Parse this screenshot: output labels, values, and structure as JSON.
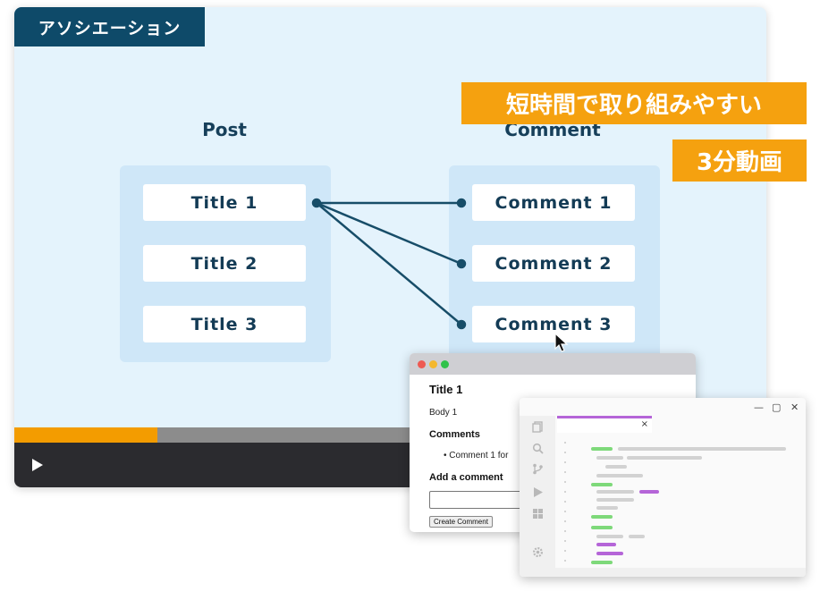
{
  "header": {
    "tag": "アソシエーション"
  },
  "slide": {
    "post_heading": "Post",
    "comment_heading": "Comment",
    "titles": [
      "Title 1",
      "Title 2",
      "Title 3"
    ],
    "comments": [
      "Comment 1",
      "Comment 2",
      "Comment 3"
    ]
  },
  "promo": {
    "line1": "短時間で取り組みやすい",
    "line2": "3分動画"
  },
  "player": {
    "progress": 0.19,
    "play_icon": "play-icon"
  },
  "browser": {
    "title": "Title 1",
    "body": "Body 1",
    "comments_heading": "Comments",
    "comment_item": "• Comment 1 for",
    "add_heading": "Add a comment",
    "submit_label": "Create Comment"
  },
  "editor": {
    "tab_close": "×",
    "window_controls": [
      "—",
      "▢",
      "✕"
    ],
    "icons": [
      "files-icon",
      "search-icon",
      "source-control-icon",
      "run-icon",
      "extensions-icon",
      "gear-icon"
    ]
  },
  "colors": {
    "brand_dark": "#0e4a69",
    "accent_orange": "#f5a10f",
    "slide_bg": "#e4f3fc",
    "panel_bg": "#cfe7f8"
  }
}
